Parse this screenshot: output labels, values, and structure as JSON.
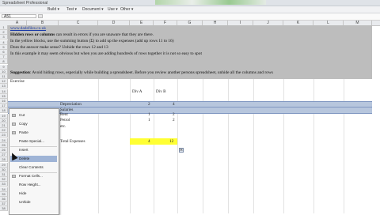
{
  "window": {
    "title": "Spreadsheet Professional"
  },
  "menubar": {
    "items": [
      "Build ▾",
      "Test ▾",
      "Document ▾",
      "Use ▾",
      "Other ▾"
    ]
  },
  "formula_bar": {
    "name_box": "A51"
  },
  "columns": [
    "A",
    "B",
    "C",
    "D",
    "E",
    "F",
    "G",
    "H",
    "I",
    "J",
    "K",
    "L",
    "M"
  ],
  "rows": [
    "1",
    "2",
    "3",
    "4",
    "5",
    "6",
    "7",
    "8",
    "9",
    "10",
    "11",
    "12",
    "13",
    "14",
    "15",
    "16",
    "17",
    "18",
    "19",
    "20",
    "21",
    "22",
    "23",
    "24",
    "25",
    "26",
    "27",
    "28",
    "29",
    "30",
    "31",
    "32",
    "33",
    "34",
    "35",
    "36",
    "37",
    "38",
    "39",
    "40",
    "41",
    "42",
    "43"
  ],
  "notes": {
    "link": "www.dadsfiles.co.uk",
    "lines": [
      {
        "bold": "Hidden rows or columns",
        "rest": " can result in errors if you are unaware that they are there."
      },
      {
        "bold": "",
        "rest": "In the yellow blocks, use the summing button (Σ) to add up the expenses (add up rows 11 to 16)"
      },
      {
        "bold": "",
        "rest": "Does the answer make sense? Unhide the rows 12 and 13"
      },
      {
        "bold": "",
        "rest": "In this example it may seem obvious but when you are adding hundreds of rows together it is not so easy to spot"
      },
      {
        "bold": "Suggestion",
        "rest": ": Avoid hiding rows, especially while building a spreadsheet. Before you review another persons spreadsheet, unhide all the columns and rows"
      }
    ],
    "exercise": "Exercise"
  },
  "table": {
    "col_headers": [
      "Div A",
      "Div B"
    ],
    "rows": [
      {
        "label": "Depreciation",
        "a": "2",
        "b": "4"
      },
      {
        "label": "Salaries",
        "a": "",
        "b": ""
      },
      {
        "label": "Rent",
        "a": "1",
        "b": "2"
      },
      {
        "label": "Petrol",
        "a": "1",
        "b": "2"
      },
      {
        "label": "etc.",
        "a": "",
        "b": ""
      }
    ],
    "total_label": "Total Expenses",
    "total_a": "4",
    "total_b": "12"
  },
  "context_menu": {
    "items": [
      "Cut",
      "Copy",
      "Paste",
      "Paste Special...",
      "Insert",
      "Delete",
      "Clear Contents",
      "Format Cells...",
      "Row Height...",
      "Hide",
      "Unhide"
    ],
    "highlighted": "Delete"
  },
  "colors": {
    "band": "#b7c6dd",
    "yellow": "#ffff33",
    "notes_bg": "#bdbdbd"
  }
}
